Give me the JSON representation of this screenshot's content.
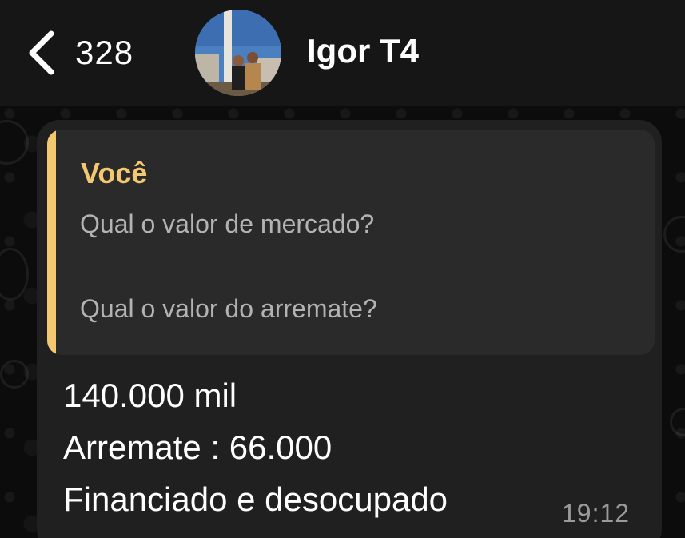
{
  "header": {
    "back_count": "328",
    "contact_name": "Igor T4"
  },
  "message": {
    "quoted": {
      "author": "Você",
      "lines": [
        "Qual o valor de mercado?",
        "Qual o valor do arremate?"
      ]
    },
    "lines": [
      "140.000 mil",
      "Arremate : 66.000",
      "Financiado e desocupado"
    ],
    "time": "19:12"
  },
  "colors": {
    "quote_accent": "#f3c871",
    "bubble": "#202020",
    "quote_bg": "#2a2a2a",
    "header_bg": "#161616"
  },
  "icons": {
    "back": "chevron-left-icon"
  }
}
